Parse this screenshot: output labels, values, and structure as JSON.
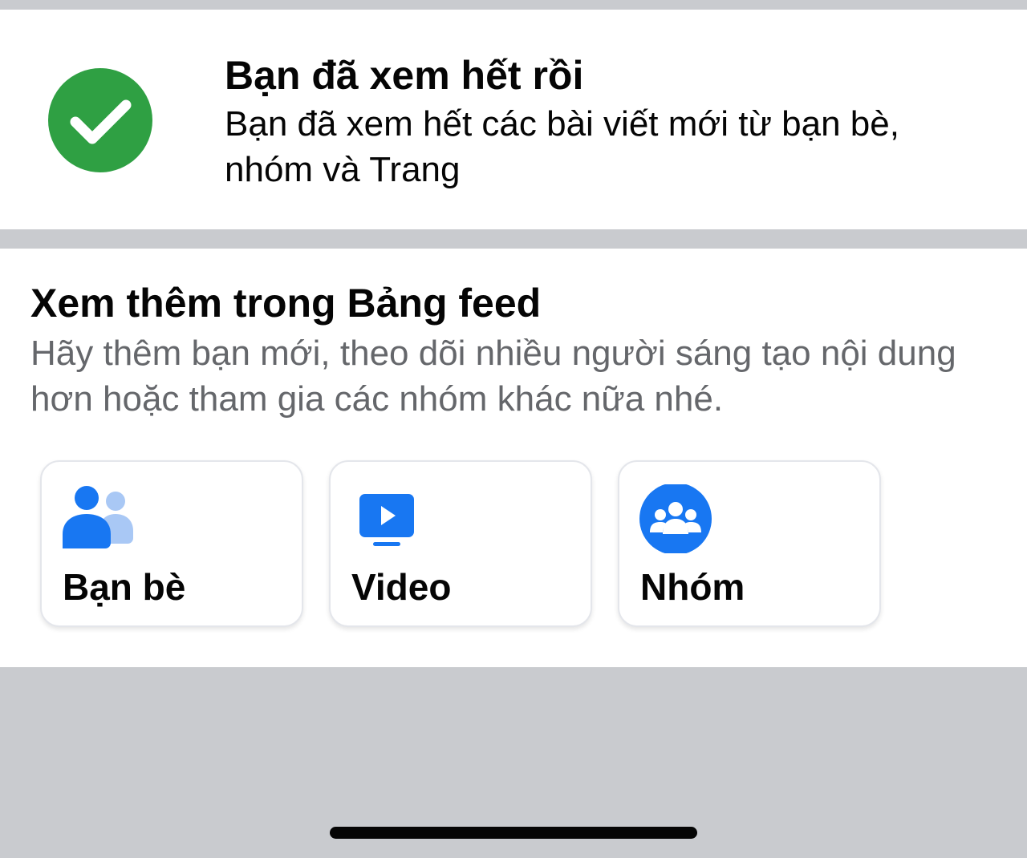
{
  "caught_up": {
    "title": "Bạn đã xem hết rồi",
    "subtitle": "Bạn đã xem hết các bài viết mới từ bạn bè, nhóm và Trang",
    "icon": "check-circle-icon",
    "icon_color": "#2fa043"
  },
  "see_more": {
    "title": "Xem thêm trong Bảng feed",
    "subtitle": "Hãy thêm bạn mới, theo dõi nhiều người sáng tạo nội dung hơn hoặc tham gia các nhóm khác nữa nhé.",
    "tiles": [
      {
        "label": "Bạn bè",
        "icon": "friends-icon"
      },
      {
        "label": "Video",
        "icon": "video-icon"
      },
      {
        "label": "Nhóm",
        "icon": "groups-icon"
      }
    ]
  },
  "colors": {
    "accent": "#1877f2",
    "background": "#c9cbcf",
    "card": "#ffffff",
    "text_primary": "#050505",
    "text_secondary": "#65676b"
  }
}
